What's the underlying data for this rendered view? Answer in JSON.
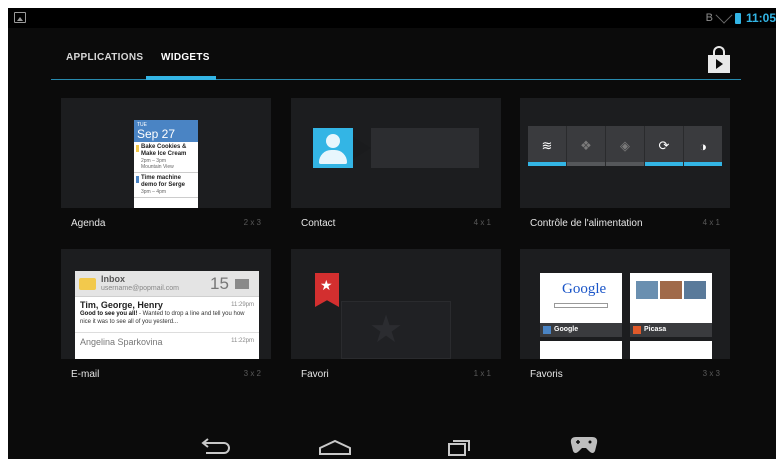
{
  "status_bar": {
    "time": "11:05",
    "bluetooth_icon": "B"
  },
  "tabs": [
    {
      "label": "APPLICATIONS",
      "selected": false
    },
    {
      "label": "WIDGETS",
      "selected": true
    }
  ],
  "widgets": [
    {
      "name": "Agenda",
      "size": "2 x 3"
    },
    {
      "name": "Contact",
      "size": "4 x 1"
    },
    {
      "name": "Contrôle de l'alimentation",
      "size": "4 x 1"
    },
    {
      "name": "E-mail",
      "size": "3 x 2"
    },
    {
      "name": "Favori",
      "size": "1 x 1"
    },
    {
      "name": "Favoris",
      "size": "3 x 3"
    }
  ],
  "agenda_preview": {
    "day": "TUE",
    "date": "Sep 27",
    "events": [
      {
        "title": "Bake Cookies & Make Ice Cream",
        "time": "2pm – 3pm",
        "place": "Mountain View",
        "color": "#f2c94c"
      },
      {
        "title": "Time machine demo for Serge",
        "time": "3pm – 4pm",
        "color": "#4a84c4"
      }
    ]
  },
  "email_preview": {
    "title": "Inbox",
    "account": "username@popmail.com",
    "count": "15",
    "messages": [
      {
        "from": "Tim, George, Henry",
        "time": "11:29pm",
        "subject": "Good to see you all!",
        "snippet": " - Wanted to drop a line and tell you how nice it was to see all of you yesterd..."
      },
      {
        "from": "Angelina Sparkovina",
        "time": "11:22pm"
      }
    ]
  },
  "bookmarks_preview": [
    {
      "label": "Google",
      "logo": "Google"
    },
    {
      "label": "Picasa"
    }
  ],
  "colors": {
    "accent": "#33b5e5",
    "background": "#0b0b0b",
    "card": "#1c1d1f",
    "ribbon": "#d32f2f"
  },
  "icons": {
    "nav": [
      "back-icon",
      "home-icon",
      "recent-apps-icon",
      "game-controller-icon"
    ],
    "store": "play-store-icon"
  }
}
